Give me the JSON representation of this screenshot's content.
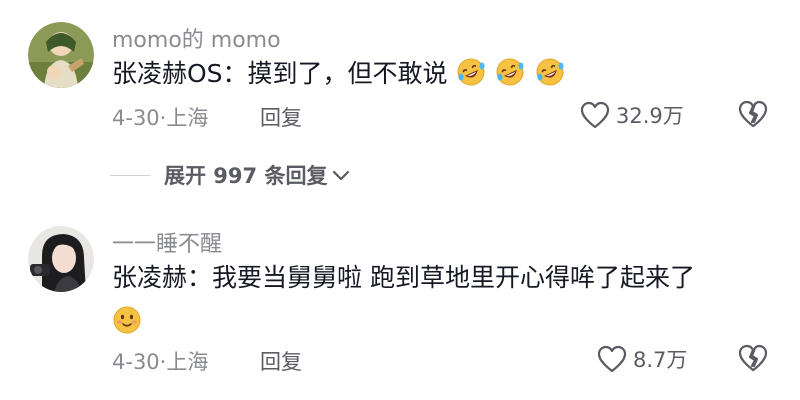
{
  "comments": [
    {
      "username": "momo的 momo",
      "text": "张凌赫OS：摸到了，但不敢说",
      "emojis": [
        "rofl-emoji",
        "rofl-emoji",
        "rofl-emoji"
      ],
      "date_location": "4-30·上海",
      "reply_label": "回复",
      "likes": "32.9万"
    },
    {
      "username": "一一睡不醒",
      "text": "张凌赫：我要当舅舅啦 跑到草地里开心得哞了起来了",
      "emojis": [
        "blush-emoji"
      ],
      "date_location": "4-30·上海",
      "reply_label": "回复",
      "likes": "8.7万"
    }
  ],
  "expand_replies": {
    "label": "展开 997 条回复"
  },
  "colors": {
    "text_primary": "#161823",
    "text_secondary": "#8a8b91",
    "action": "#5a5b63",
    "emoji_face": "#f7c244"
  }
}
